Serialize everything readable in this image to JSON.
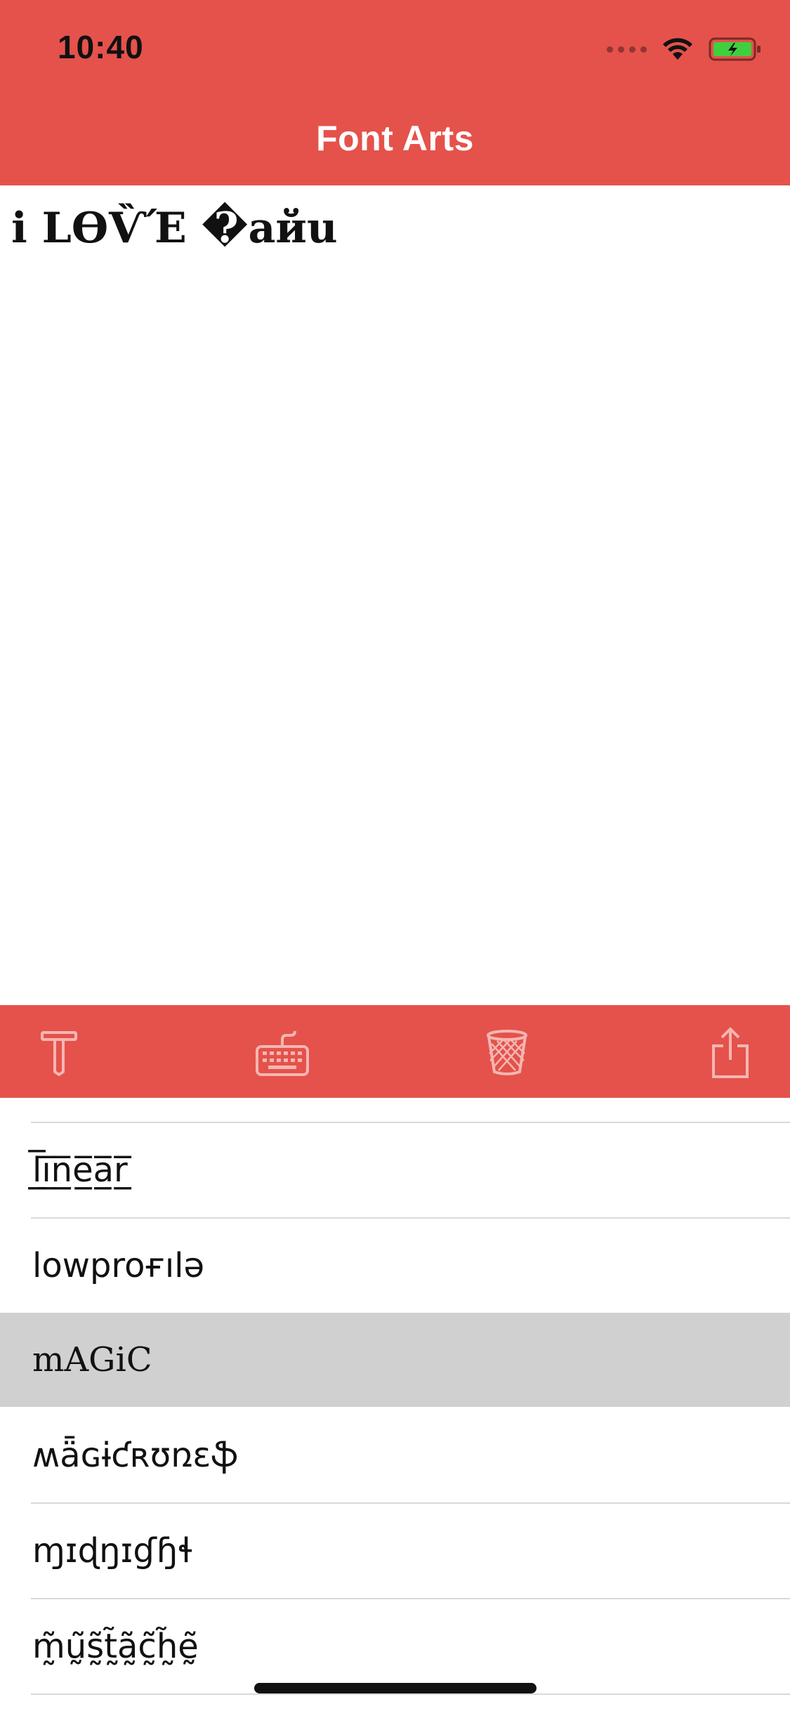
{
  "status_bar": {
    "time": "10:40",
    "battery_color": "#3fcf3f"
  },
  "nav": {
    "title": "Font Arts"
  },
  "editor": {
    "text": "i LϴѶΈ �айu"
  },
  "toolbar": {
    "items": [
      {
        "icon": "text-icon"
      },
      {
        "icon": "keyboard-icon"
      },
      {
        "icon": "trash-icon"
      },
      {
        "icon": "share-icon"
      }
    ]
  },
  "font_list": {
    "items": [
      {
        "label": "l̲̅i̲̅n̲̅e̲̅a̲̅r̲̅"
      },
      {
        "label": "lowproғılə"
      },
      {
        "label": "mAGiC",
        "selected": true
      },
      {
        "label": "ʍǟɢɨƈʀʊռɛֆ"
      },
      {
        "label": "ɱɪɖŋɪɠɧɬ"
      },
      {
        "label": "m̰̃ṵ̃s̰̃t̰̃ã̰c̰̃h̰̃ḛ̃"
      }
    ]
  },
  "colors": {
    "accent": "#e4524b",
    "selected_row": "#d0d0d0"
  }
}
